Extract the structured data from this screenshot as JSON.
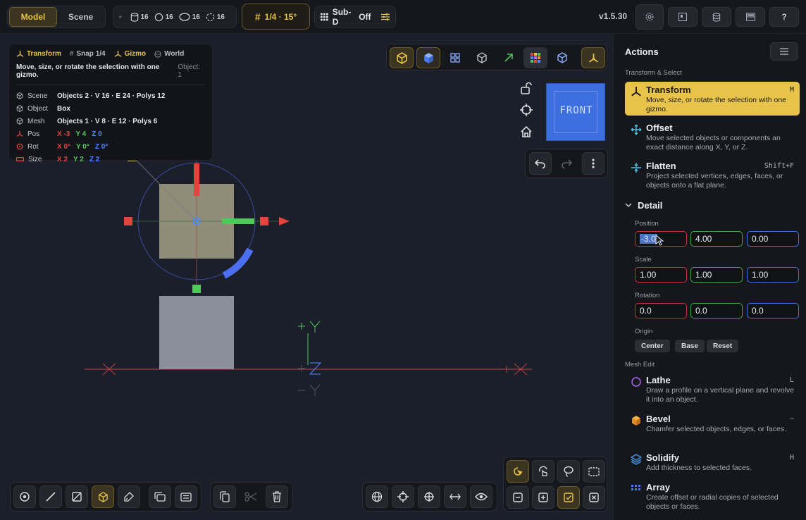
{
  "topbar": {
    "modes": [
      "Model",
      "Scene"
    ],
    "active_mode": "Model",
    "stats": [
      "16",
      "16",
      "16",
      "16"
    ],
    "snap_label": "1/4 · 15°",
    "subd_label": "Sub-D",
    "subd_state": "Off",
    "version": "v1.5.30"
  },
  "info": {
    "head": {
      "transform": "Transform",
      "snap": "Snap 1/4",
      "gizmo": "Gizmo",
      "world": "World"
    },
    "desc": "Move, size, or rotate the selection with one gizmo.",
    "object_count": "Object: 1",
    "rows": {
      "scene_label": "Scene",
      "scene_value": "Objects 2 · V 16 · E 24 · Polys 12",
      "object_label": "Object",
      "object_value": "Box",
      "mesh_label": "Mesh",
      "mesh_value": "Objects 1 · V 8 · E 12 · Polys 6",
      "pos_label": "Pos",
      "pos_x": "X -3",
      "pos_y": "Y 4",
      "pos_z": "Z 0",
      "rot_label": "Rot",
      "rot_x": "X 0°",
      "rot_y": "Y 0°",
      "rot_z": "Z 0°",
      "size_label": "Size",
      "size_x": "X 2",
      "size_y": "Y 2",
      "size_z": "Z 2"
    }
  },
  "viewcube_label": "FRONT",
  "panel": {
    "title": "Actions",
    "section_transform": "Transform & Select",
    "actions": [
      {
        "title": "Transform",
        "desc": "Move, size, or rotate the selection with one gizmo.",
        "key": "M"
      },
      {
        "title": "Offset",
        "desc": "Move selected objects or components an exact distance along X, Y, or Z.",
        "key": ""
      },
      {
        "title": "Flatten",
        "desc": "Project selected vertices, edges, faces, or objects onto a flat plane.",
        "key": "Shift+F"
      }
    ],
    "detail_label": "Detail",
    "position_label": "Position",
    "position": [
      "-3.0",
      "4.00",
      "0.00"
    ],
    "scale_label": "Scale",
    "scale": [
      "1.00",
      "1.00",
      "1.00"
    ],
    "rotation_label": "Rotation",
    "rotation": [
      "0.0",
      "0.0",
      "0.0"
    ],
    "origin_label": "Origin",
    "origin_buttons": [
      "Center",
      "Base",
      "Reset"
    ],
    "section_mesh": "Mesh Edit",
    "mesh_actions": [
      {
        "title": "Lathe",
        "desc": "Draw a profile on a vertical plane and revolve it into an object.",
        "key": "L"
      },
      {
        "title": "Bevel",
        "desc": "Chamfer selected objects, edges, or faces.",
        "key": "–"
      },
      {
        "title": "Solidify",
        "desc": "Add thickness to selected faces.",
        "key": "H"
      },
      {
        "title": "Array",
        "desc": "Create offset or radial copies of selected objects or faces.",
        "key": ""
      }
    ]
  },
  "colors": {
    "accent": "#e8c34a",
    "x_axis": "#e0453e",
    "y_axis": "#4ec95a",
    "z_axis": "#4a8cff"
  }
}
